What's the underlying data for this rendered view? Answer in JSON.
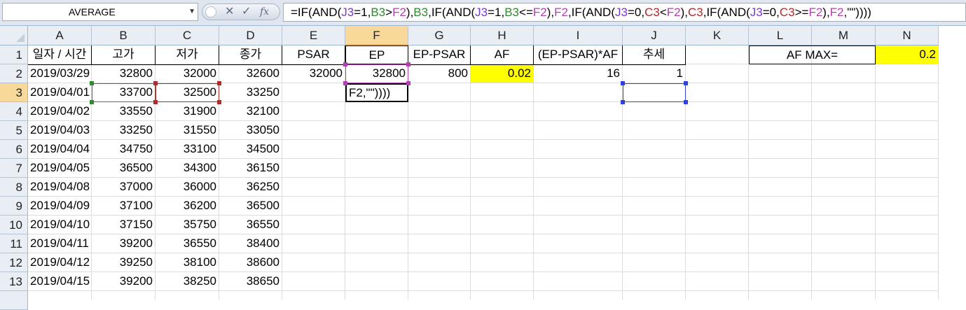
{
  "formula_bar": {
    "name_box": "AVERAGE",
    "cancel_glyph": "✕",
    "enter_glyph": "✓",
    "fx_label": "fx",
    "formula_parts": [
      {
        "t": "=IF(AND(",
        "c": ""
      },
      {
        "t": "J3",
        "c": "purple"
      },
      {
        "t": "=1,",
        "c": ""
      },
      {
        "t": "B3",
        "c": "green"
      },
      {
        "t": ">",
        "c": ""
      },
      {
        "t": "F2",
        "c": "magenta"
      },
      {
        "t": "),",
        "c": ""
      },
      {
        "t": "B3",
        "c": "green"
      },
      {
        "t": ",IF(AND(",
        "c": ""
      },
      {
        "t": "J3",
        "c": "purple"
      },
      {
        "t": "=1,",
        "c": ""
      },
      {
        "t": "B3",
        "c": "green"
      },
      {
        "t": "<=",
        "c": ""
      },
      {
        "t": "F2",
        "c": "magenta"
      },
      {
        "t": "),",
        "c": ""
      },
      {
        "t": "F2",
        "c": "magenta"
      },
      {
        "t": ",IF(AND(",
        "c": ""
      },
      {
        "t": "J3",
        "c": "purple"
      },
      {
        "t": "=0,",
        "c": ""
      },
      {
        "t": "C3",
        "c": "red"
      },
      {
        "t": "<",
        "c": ""
      },
      {
        "t": "F2",
        "c": "magenta"
      },
      {
        "t": "),",
        "c": ""
      },
      {
        "t": "C3",
        "c": "red"
      },
      {
        "t": ",IF(AND(",
        "c": ""
      },
      {
        "t": "J3",
        "c": "purple"
      },
      {
        "t": "=0,",
        "c": ""
      },
      {
        "t": "C3",
        "c": "red"
      },
      {
        "t": ">=",
        "c": ""
      },
      {
        "t": "F2",
        "c": "magenta"
      },
      {
        "t": "),",
        "c": ""
      },
      {
        "t": "F2",
        "c": "magenta"
      },
      {
        "t": ",\"\"))))",
        "c": ""
      }
    ]
  },
  "columns": [
    "A",
    "B",
    "C",
    "D",
    "E",
    "F",
    "G",
    "H",
    "I",
    "J",
    "K",
    "L",
    "M",
    "N"
  ],
  "active_column": "F",
  "rows": [
    "1",
    "2",
    "3",
    "4",
    "5",
    "6",
    "7",
    "8",
    "9",
    "10",
    "11",
    "12",
    "13"
  ],
  "active_row": "3",
  "header_row": {
    "A": "일자 / 시간",
    "B": "고가",
    "C": "저가",
    "D": "종가",
    "E": "PSAR",
    "F": "EP",
    "G": "EP-PSAR",
    "H": "AF",
    "I": "(EP-PSAR)*AF",
    "J": "추세",
    "LM": "AF MAX=",
    "N": "0.2"
  },
  "row2": {
    "A": "2019/03/29",
    "B": "32800",
    "C": "32000",
    "D": "32600",
    "E": "32000",
    "F": "32800",
    "G": "800",
    "H": "0.02",
    "I": "16",
    "J": "1"
  },
  "edit_cell_text": "F2,\"\"))))",
  "data_rows": [
    {
      "date": "2019/04/01",
      "high": "33700",
      "low": "32500",
      "close": "33250"
    },
    {
      "date": "2019/04/02",
      "high": "33550",
      "low": "31900",
      "close": "32100"
    },
    {
      "date": "2019/04/03",
      "high": "33250",
      "low": "31550",
      "close": "33050"
    },
    {
      "date": "2019/04/04",
      "high": "34750",
      "low": "33100",
      "close": "34500"
    },
    {
      "date": "2019/04/05",
      "high": "36500",
      "low": "34300",
      "close": "36150"
    },
    {
      "date": "2019/04/08",
      "high": "37000",
      "low": "36000",
      "close": "36250"
    },
    {
      "date": "2019/04/09",
      "high": "37100",
      "low": "36200",
      "close": "36500"
    },
    {
      "date": "2019/04/10",
      "high": "37150",
      "low": "35750",
      "close": "36550"
    },
    {
      "date": "2019/04/11",
      "high": "39200",
      "low": "36550",
      "close": "38400"
    },
    {
      "date": "2019/04/12",
      "high": "39250",
      "low": "38100",
      "close": "38600"
    },
    {
      "date": "2019/04/15",
      "high": "39200",
      "low": "38250",
      "close": "38650"
    }
  ],
  "colors": {
    "yellow_fill": "#ffff00",
    "ref_purple": "#7a39c8",
    "ref_green": "#2d8a2d",
    "ref_red": "#b02a2a",
    "ref_magenta": "#b53db5",
    "ref_blue": "#3043d9"
  }
}
